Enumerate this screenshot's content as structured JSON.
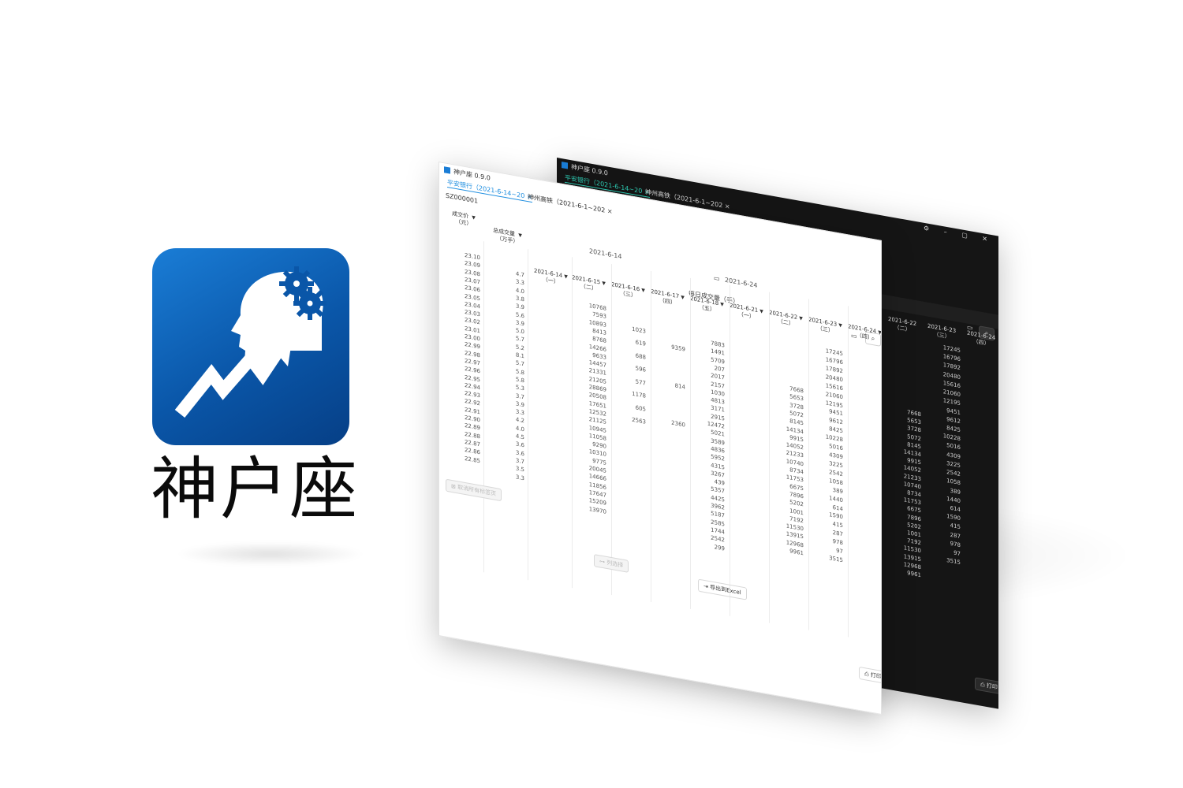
{
  "app": {
    "name": "神户座",
    "version_title": "神户座 0.9.0",
    "brand_color": "#0a56a8"
  },
  "tabs": [
    {
      "label": "平安银行（2021-6-14~20",
      "close": "×"
    },
    {
      "label": "神州高铁（2021-6-1~202",
      "close": "×"
    }
  ],
  "stock_code": "SZ000001",
  "date_range": {
    "start": "2021-6-14",
    "end": "2021-6-24"
  },
  "labels": {
    "price_header_1": "成交价",
    "price_header_2": "（元）",
    "total_header_1": "总成交量",
    "total_header_2": "（万手）",
    "daily_header": "每日成交量（手）",
    "filter_icon": "▼"
  },
  "day_columns": [
    {
      "date": "2021-6-14",
      "weekday": "（一）"
    },
    {
      "date": "2021-6-15",
      "weekday": "（二）"
    },
    {
      "date": "2021-6-16",
      "weekday": "（三）"
    },
    {
      "date": "2021-6-17",
      "weekday": "（四）"
    },
    {
      "date": "2021-6-18",
      "weekday": "（五）"
    },
    {
      "date": "2021-6-21",
      "weekday": "（一）"
    },
    {
      "date": "2021-6-22",
      "weekday": "（二）"
    },
    {
      "date": "2021-6-23",
      "weekday": "（三）"
    },
    {
      "date": "2021-6-24",
      "weekday": "（四）"
    }
  ],
  "prices": [
    "23.10",
    "23.09",
    "23.08",
    "23.07",
    "23.06",
    "23.05",
    "23.04",
    "23.03",
    "23.02",
    "23.01",
    "23.00",
    "22.99",
    "22.98",
    "22.97",
    "22.96",
    "22.95",
    "22.94",
    "22.93",
    "22.92",
    "22.91",
    "22.90",
    "22.89",
    "22.88",
    "22.87",
    "22.86",
    "22.85"
  ],
  "totals": [
    "4.7",
    "3.3",
    "4.0",
    "3.8",
    "3.9",
    "5.6",
    "3.9",
    "5.0",
    "5.7",
    "5.2",
    "8.1",
    "5.7",
    "5.8",
    "5.8",
    "5.3",
    "3.7",
    "3.9",
    "3.3",
    "4.2",
    "4.0",
    "4.5",
    "3.6",
    "3.6",
    "3.7",
    "3.5",
    "3.3"
  ],
  "col_0615": [
    "10768",
    "7593",
    "10893",
    "8413",
    "8768",
    "14266",
    "9633",
    "14457",
    "21331",
    "21205",
    "28869",
    "20508",
    "17651",
    "12532",
    "21125",
    "10945",
    "11058",
    "9290",
    "10310",
    "9775",
    "20045",
    "14666",
    "11856",
    "17647",
    "15209",
    "13970"
  ],
  "col_0616": [
    "1023",
    "619",
    "688",
    "596",
    "577",
    "1178",
    "605",
    "2563"
  ],
  "col_0617": [
    "9359",
    "814",
    "2360"
  ],
  "col_0618": [
    "7883",
    "1491",
    "5709",
    "207",
    "2017",
    "2157",
    "1030",
    "4813",
    "3171",
    "2915",
    "12472",
    "5021",
    "3589",
    "4836",
    "5952",
    "4315",
    "3267",
    "439",
    "5357",
    "4425",
    "3962",
    "5187",
    "2585",
    "1744",
    "2542",
    "299"
  ],
  "col_0622": [
    "7668",
    "5653",
    "3728",
    "5072",
    "8145",
    "14134",
    "9915",
    "14052",
    "21233",
    "10740",
    "8734",
    "11753",
    "6675",
    "7896",
    "5202",
    "1001",
    "7192",
    "11530",
    "13915",
    "12968",
    "9961"
  ],
  "col_0623": [
    "17245",
    "16796",
    "17892",
    "20480",
    "15616",
    "21060",
    "12195",
    "9451",
    "9612",
    "8425",
    "10228",
    "5016",
    "4309",
    "3225",
    "2542",
    "1058",
    "389",
    "1440",
    "614",
    "1590",
    "415",
    "287",
    "978",
    "97",
    "3515"
  ],
  "buttons": {
    "close_all": "取消所有标签页",
    "column_settings": "列选择",
    "export_excel": "导出到Excel",
    "print": "打印",
    "search_icon": "search-icon",
    "calendar_icon": "calendar-icon"
  },
  "window_controls": "⚙ – ▢ ✕"
}
